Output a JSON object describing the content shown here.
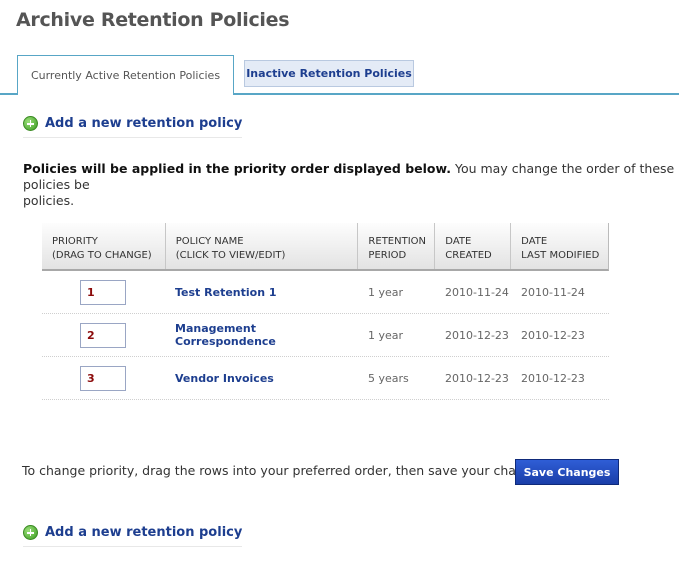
{
  "page": {
    "title": "Archive Retention Policies"
  },
  "tabs": [
    {
      "label": "Currently Active Retention Policies",
      "active": true
    },
    {
      "label": "Inactive Retention Policies",
      "active": false
    }
  ],
  "add_link": {
    "label": "Add a new retention policy",
    "icon": "plus-circle-icon"
  },
  "intro": {
    "bold": "Policies will be applied in the priority order displayed below.",
    "rest": " You may change the order of these policies be",
    "line2": "policies."
  },
  "table": {
    "headers": [
      {
        "line1": "PRIORITY",
        "line2": "(DRAG TO CHANGE)"
      },
      {
        "line1": "POLICY NAME",
        "line2": "(CLICK TO VIEW/EDIT)"
      },
      {
        "line1": "RETENTION",
        "line2": "PERIOD"
      },
      {
        "line1": "DATE",
        "line2": "CREATED"
      },
      {
        "line1": "DATE",
        "line2": "LAST MODIFIED"
      }
    ],
    "rows": [
      {
        "priority": "1",
        "name": "Test Retention 1",
        "period": "1 year",
        "created": "2010-11-24",
        "modified": "2010-11-24"
      },
      {
        "priority": "2",
        "name": "Management Correspondence",
        "period": "1 year",
        "created": "2010-12-23",
        "modified": "2010-12-23"
      },
      {
        "priority": "3",
        "name": "Vendor Invoices",
        "period": "5 years",
        "created": "2010-12-23",
        "modified": "2010-12-23"
      }
    ]
  },
  "footer": {
    "text": "To change priority, drag the rows into your preferred order, then save your changes:",
    "save_label": "Save Changes"
  },
  "colors": {
    "link": "#1d3e8f",
    "tab_border": "#58a6c6",
    "priority_text": "#8b0a0a",
    "button": "#1a3ea8"
  }
}
